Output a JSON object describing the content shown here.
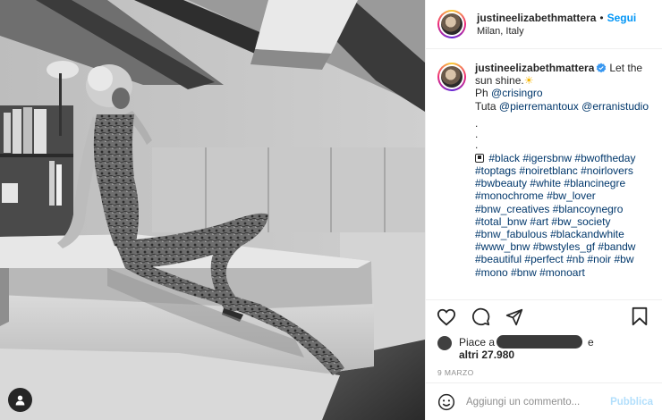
{
  "header": {
    "username": "justineelizabethmattera",
    "separator": "•",
    "follow_label": "Segui",
    "location": "Milan, Italy"
  },
  "caption": {
    "username": "justineelizabethmattera",
    "text_1": "Let the sun shine.",
    "sun_emoji": "☀",
    "ph_prefix": "Ph ",
    "ph_handle": "@crisingro",
    "tuta_prefix": "Tuta ",
    "tuta_handle_1": "@pierremantoux",
    "tuta_handle_2": "@erranistudio",
    "dot_lines": [
      ".",
      ".",
      "."
    ],
    "hashtags": [
      "#black",
      "#igersbnw",
      "#bwoftheday",
      "#toptags",
      "#noiretblanc",
      "#noirlovers",
      "#bwbeauty",
      "#white",
      "#blancinegre",
      "#monochrome",
      "#bw_lover",
      "#bnw_creatives",
      "#blancoynegro",
      "#total_bnw",
      "#art",
      "#bw_society",
      "#bnw_fabulous",
      "#blackandwhite",
      "#www_bnw",
      "#bwstyles_gf",
      "#bandw",
      "#beautiful",
      "#perfect",
      "#nb",
      "#noir",
      "#bw",
      "#mono",
      "#bnw",
      "#monoart"
    ]
  },
  "actions": {
    "like_icon": "heart-icon",
    "comment_icon": "comment-icon",
    "share_icon": "share-icon",
    "save_icon": "bookmark-icon"
  },
  "likes": {
    "prefix": "Piace a",
    "conjunction": "e",
    "others": "altri 27.980"
  },
  "date": "9 MARZO",
  "comment": {
    "placeholder": "Aggiungi un commento...",
    "publish_label": "Pubblica"
  },
  "colors": {
    "link": "#00376b",
    "follow": "#0095f6",
    "publish_disabled": "#b2dffc",
    "muted": "#8e8e8e"
  }
}
